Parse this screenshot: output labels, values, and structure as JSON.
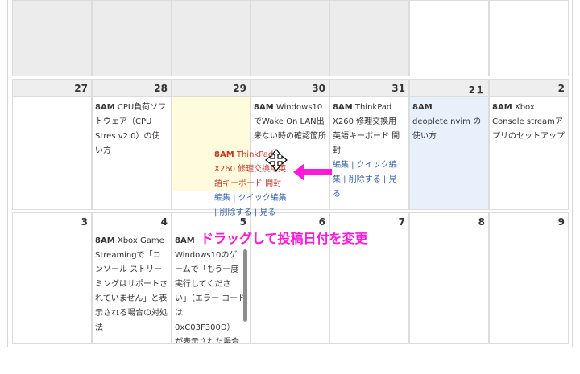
{
  "weeks": [
    {
      "days": [
        "",
        "",
        "",
        "",
        "",
        "",
        ""
      ]
    },
    {
      "days": [
        "27",
        "28",
        "29",
        "30",
        "31",
        "2１",
        "2"
      ]
    },
    {
      "days": [
        "3",
        "4",
        "5",
        "6",
        "7",
        "8",
        "9"
      ]
    }
  ],
  "posts": {
    "d28": {
      "time": "8AM",
      "title_lines": [
        "CPU負荷ソフ",
        "トウェア（CPU",
        "Stres v2.0）の使",
        "い方"
      ]
    },
    "d30": {
      "time": "8AM",
      "title_lines": [
        "Windows10",
        "でWake On LAN出",
        "来ない時の確認箇所"
      ]
    },
    "d31": {
      "time": "8AM",
      "title_lines": [
        "ThinkPad",
        "X260 修理交換用",
        "英語キーボード 開",
        "封"
      ],
      "links": [
        "編集 | クイック編",
        "集 | 削除する | 見",
        "る"
      ]
    },
    "d2_1": {
      "time": "8AM",
      "title_lines": [
        "deoplete.nvim の",
        "使い方"
      ]
    },
    "d2": {
      "time": "8AM",
      "title_lines": [
        "Xbox",
        "Console streamア",
        "プリのセットアップ"
      ]
    },
    "d4": {
      "time": "8AM",
      "title_lines": [
        "Xbox Game",
        "Streamingで「コ",
        "ンソール ストリー",
        "ミングはサポートさ",
        "れていません」と表",
        "示される場合の対処",
        "法"
      ]
    },
    "d5": {
      "time": "8AM",
      "title_lines": [
        "Windows10のゲ",
        "ームで「もう一度",
        "実行してくださ",
        "い」（エラー コード",
        "は",
        "0xC03F300D）",
        "が表示された場合"
      ]
    }
  },
  "dragging": {
    "time": "8AM",
    "title_lines": [
      "ThinkPad",
      "X260 修理交換用英",
      "語キーボード 開封"
    ],
    "links": [
      "編集 | クイック編集",
      "| 削除する | 見る"
    ]
  },
  "callout": "ドラッグして投稿日付を変更",
  "colors": {
    "accent": "#ff19d8",
    "link": "#3a66a7",
    "drag_text": "#c0392b",
    "today_bg": "#e8f0fb",
    "highlight_bg": "#fffbdc"
  }
}
